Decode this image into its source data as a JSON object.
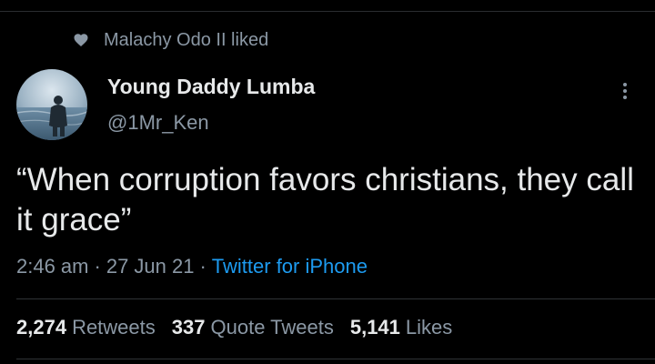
{
  "liked_banner": {
    "icon": "heart-icon",
    "text": "Malachy Odo II liked"
  },
  "author": {
    "avatar": "avatar",
    "name": "Young Daddy Lumba",
    "handle": "@1Mr_Ken"
  },
  "more_icon": "more-vertical-icon",
  "tweet": {
    "text": "“When corruption favors christians, they call it grace”"
  },
  "meta": {
    "time": "2:46 am",
    "separator": "·",
    "date": "27 Jun 21",
    "source": "Twitter for iPhone"
  },
  "stats": {
    "retweets_count": "2,274",
    "retweets_label": "Retweets",
    "quotes_count": "337",
    "quotes_label": "Quote Tweets",
    "likes_count": "5,141",
    "likes_label": "Likes"
  },
  "colors": {
    "background": "#000000",
    "text_primary": "#e7e9ea",
    "text_secondary": "#8b98a5",
    "link": "#1d9bf0",
    "divider": "#2f3336"
  }
}
